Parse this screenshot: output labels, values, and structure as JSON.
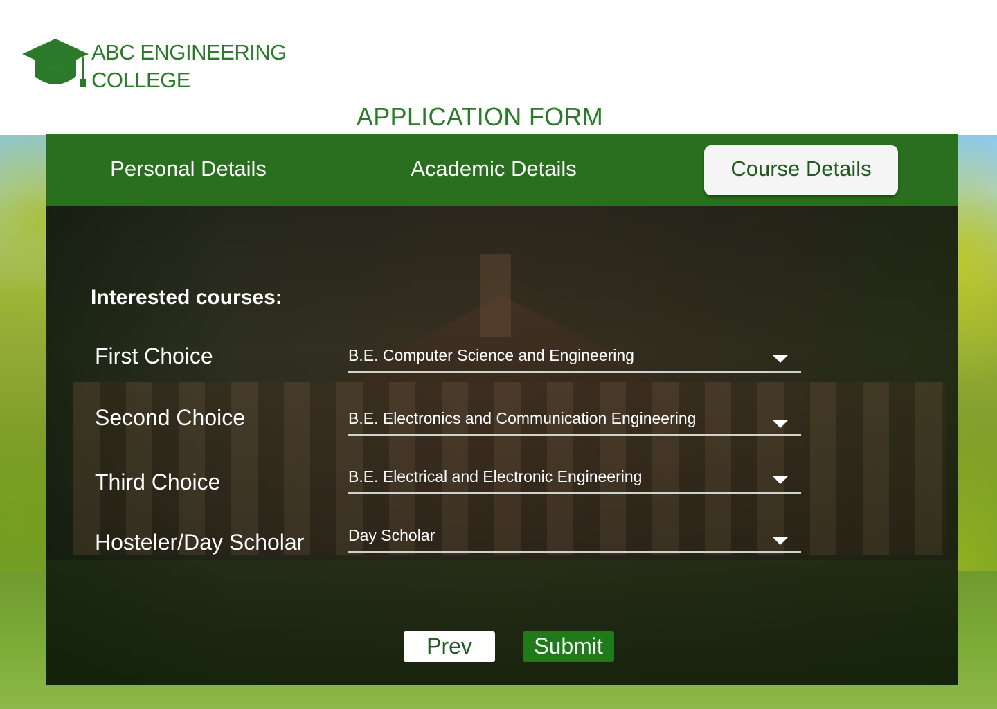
{
  "brand": {
    "name_line1": "ABC ENGINEERING",
    "name_line2": "COLLEGE",
    "icon": "graduation-cap-icon",
    "color": "#2a7a2a"
  },
  "page_title": "APPLICATION FORM",
  "tabs": [
    {
      "label": "Personal Details",
      "active": false
    },
    {
      "label": "Academic Details",
      "active": false
    },
    {
      "label": "Course Details",
      "active": true
    }
  ],
  "form": {
    "heading": "Interested courses:",
    "fields": [
      {
        "label": "First Choice",
        "value": "B.E. Computer Science and Engineering"
      },
      {
        "label": "Second Choice",
        "value": "B.E. Electronics and Communication Engineering"
      },
      {
        "label": "Third Choice",
        "value": "B.E. Electrical and Electronic Engineering"
      },
      {
        "label": "Hosteler/Day Scholar",
        "value": "Day Scholar"
      }
    ]
  },
  "buttons": {
    "prev": "Prev",
    "submit": "Submit"
  },
  "colors": {
    "tab_bar": "#2a6f20",
    "submit": "#1f7a1a",
    "panel": "#141a12"
  }
}
